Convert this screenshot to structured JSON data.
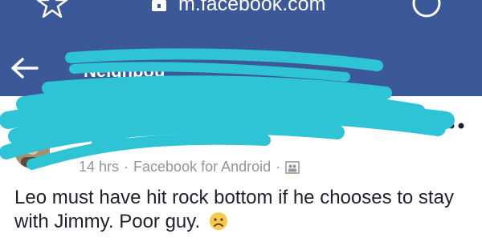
{
  "browser": {
    "url": "m.facebook.com"
  },
  "header": {
    "group_title": "Neighbou",
    "back_icon": "arrow-left-icon"
  },
  "post": {
    "author_name": "",
    "time": "14 hrs",
    "source": "Facebook for Android",
    "meta_separator": "·",
    "text": "Leo must have hit rock bottom if he chooses to stay with Jimmy. Poor guy.",
    "emoji": "sad-face"
  },
  "colors": {
    "brand_blue": "#3b5998",
    "redaction": "#2ec4d6",
    "meta_gray": "#90949c",
    "emoji_yellow": "#f7c94b"
  }
}
